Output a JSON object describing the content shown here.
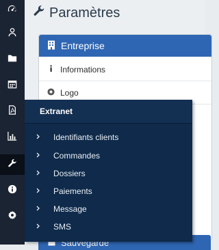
{
  "page": {
    "title": "Paramètres"
  },
  "panel": {
    "title": "Entreprise",
    "items": [
      {
        "label": "Informations"
      },
      {
        "label": "Logo"
      }
    ]
  },
  "panel2": {
    "title": "Sauvegarde"
  },
  "flyout": {
    "title": "Extranet",
    "items": [
      {
        "label": "Identifiants clients"
      },
      {
        "label": "Commandes"
      },
      {
        "label": "Dossiers"
      },
      {
        "label": "Paiements"
      },
      {
        "label": "Message"
      },
      {
        "label": "SMS"
      }
    ]
  },
  "sidebar": {
    "icons": [
      "dashboard-icon",
      "user-icon",
      "folder-icon",
      "calendar-icon",
      "pdf-file-icon",
      "bar-chart-icon",
      "wrench-icon",
      "info-icon",
      "gear-icon"
    ],
    "active": "wrench-icon"
  },
  "colors": {
    "sidebar_bg": "#1b2433",
    "panel_header": "#2f66b3",
    "flyout_bg": "#0f2a4a"
  }
}
